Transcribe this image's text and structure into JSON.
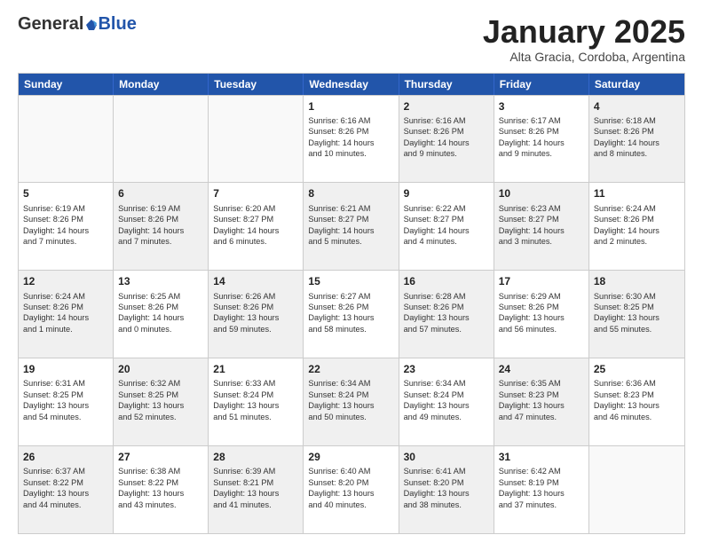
{
  "header": {
    "logo_general": "General",
    "logo_blue": "Blue",
    "title": "January 2025",
    "subtitle": "Alta Gracia, Cordoba, Argentina"
  },
  "weekdays": [
    "Sunday",
    "Monday",
    "Tuesday",
    "Wednesday",
    "Thursday",
    "Friday",
    "Saturday"
  ],
  "weeks": [
    [
      {
        "day": "",
        "info": "",
        "shaded": false,
        "empty": true
      },
      {
        "day": "",
        "info": "",
        "shaded": false,
        "empty": true
      },
      {
        "day": "",
        "info": "",
        "shaded": false,
        "empty": true
      },
      {
        "day": "1",
        "info": "Sunrise: 6:16 AM\nSunset: 8:26 PM\nDaylight: 14 hours\nand 10 minutes.",
        "shaded": false,
        "empty": false
      },
      {
        "day": "2",
        "info": "Sunrise: 6:16 AM\nSunset: 8:26 PM\nDaylight: 14 hours\nand 9 minutes.",
        "shaded": true,
        "empty": false
      },
      {
        "day": "3",
        "info": "Sunrise: 6:17 AM\nSunset: 8:26 PM\nDaylight: 14 hours\nand 9 minutes.",
        "shaded": false,
        "empty": false
      },
      {
        "day": "4",
        "info": "Sunrise: 6:18 AM\nSunset: 8:26 PM\nDaylight: 14 hours\nand 8 minutes.",
        "shaded": true,
        "empty": false
      }
    ],
    [
      {
        "day": "5",
        "info": "Sunrise: 6:19 AM\nSunset: 8:26 PM\nDaylight: 14 hours\nand 7 minutes.",
        "shaded": false,
        "empty": false
      },
      {
        "day": "6",
        "info": "Sunrise: 6:19 AM\nSunset: 8:26 PM\nDaylight: 14 hours\nand 7 minutes.",
        "shaded": true,
        "empty": false
      },
      {
        "day": "7",
        "info": "Sunrise: 6:20 AM\nSunset: 8:27 PM\nDaylight: 14 hours\nand 6 minutes.",
        "shaded": false,
        "empty": false
      },
      {
        "day": "8",
        "info": "Sunrise: 6:21 AM\nSunset: 8:27 PM\nDaylight: 14 hours\nand 5 minutes.",
        "shaded": true,
        "empty": false
      },
      {
        "day": "9",
        "info": "Sunrise: 6:22 AM\nSunset: 8:27 PM\nDaylight: 14 hours\nand 4 minutes.",
        "shaded": false,
        "empty": false
      },
      {
        "day": "10",
        "info": "Sunrise: 6:23 AM\nSunset: 8:27 PM\nDaylight: 14 hours\nand 3 minutes.",
        "shaded": true,
        "empty": false
      },
      {
        "day": "11",
        "info": "Sunrise: 6:24 AM\nSunset: 8:26 PM\nDaylight: 14 hours\nand 2 minutes.",
        "shaded": false,
        "empty": false
      }
    ],
    [
      {
        "day": "12",
        "info": "Sunrise: 6:24 AM\nSunset: 8:26 PM\nDaylight: 14 hours\nand 1 minute.",
        "shaded": true,
        "empty": false
      },
      {
        "day": "13",
        "info": "Sunrise: 6:25 AM\nSunset: 8:26 PM\nDaylight: 14 hours\nand 0 minutes.",
        "shaded": false,
        "empty": false
      },
      {
        "day": "14",
        "info": "Sunrise: 6:26 AM\nSunset: 8:26 PM\nDaylight: 13 hours\nand 59 minutes.",
        "shaded": true,
        "empty": false
      },
      {
        "day": "15",
        "info": "Sunrise: 6:27 AM\nSunset: 8:26 PM\nDaylight: 13 hours\nand 58 minutes.",
        "shaded": false,
        "empty": false
      },
      {
        "day": "16",
        "info": "Sunrise: 6:28 AM\nSunset: 8:26 PM\nDaylight: 13 hours\nand 57 minutes.",
        "shaded": true,
        "empty": false
      },
      {
        "day": "17",
        "info": "Sunrise: 6:29 AM\nSunset: 8:26 PM\nDaylight: 13 hours\nand 56 minutes.",
        "shaded": false,
        "empty": false
      },
      {
        "day": "18",
        "info": "Sunrise: 6:30 AM\nSunset: 8:25 PM\nDaylight: 13 hours\nand 55 minutes.",
        "shaded": true,
        "empty": false
      }
    ],
    [
      {
        "day": "19",
        "info": "Sunrise: 6:31 AM\nSunset: 8:25 PM\nDaylight: 13 hours\nand 54 minutes.",
        "shaded": false,
        "empty": false
      },
      {
        "day": "20",
        "info": "Sunrise: 6:32 AM\nSunset: 8:25 PM\nDaylight: 13 hours\nand 52 minutes.",
        "shaded": true,
        "empty": false
      },
      {
        "day": "21",
        "info": "Sunrise: 6:33 AM\nSunset: 8:24 PM\nDaylight: 13 hours\nand 51 minutes.",
        "shaded": false,
        "empty": false
      },
      {
        "day": "22",
        "info": "Sunrise: 6:34 AM\nSunset: 8:24 PM\nDaylight: 13 hours\nand 50 minutes.",
        "shaded": true,
        "empty": false
      },
      {
        "day": "23",
        "info": "Sunrise: 6:34 AM\nSunset: 8:24 PM\nDaylight: 13 hours\nand 49 minutes.",
        "shaded": false,
        "empty": false
      },
      {
        "day": "24",
        "info": "Sunrise: 6:35 AM\nSunset: 8:23 PM\nDaylight: 13 hours\nand 47 minutes.",
        "shaded": true,
        "empty": false
      },
      {
        "day": "25",
        "info": "Sunrise: 6:36 AM\nSunset: 8:23 PM\nDaylight: 13 hours\nand 46 minutes.",
        "shaded": false,
        "empty": false
      }
    ],
    [
      {
        "day": "26",
        "info": "Sunrise: 6:37 AM\nSunset: 8:22 PM\nDaylight: 13 hours\nand 44 minutes.",
        "shaded": true,
        "empty": false
      },
      {
        "day": "27",
        "info": "Sunrise: 6:38 AM\nSunset: 8:22 PM\nDaylight: 13 hours\nand 43 minutes.",
        "shaded": false,
        "empty": false
      },
      {
        "day": "28",
        "info": "Sunrise: 6:39 AM\nSunset: 8:21 PM\nDaylight: 13 hours\nand 41 minutes.",
        "shaded": true,
        "empty": false
      },
      {
        "day": "29",
        "info": "Sunrise: 6:40 AM\nSunset: 8:20 PM\nDaylight: 13 hours\nand 40 minutes.",
        "shaded": false,
        "empty": false
      },
      {
        "day": "30",
        "info": "Sunrise: 6:41 AM\nSunset: 8:20 PM\nDaylight: 13 hours\nand 38 minutes.",
        "shaded": true,
        "empty": false
      },
      {
        "day": "31",
        "info": "Sunrise: 6:42 AM\nSunset: 8:19 PM\nDaylight: 13 hours\nand 37 minutes.",
        "shaded": false,
        "empty": false
      },
      {
        "day": "",
        "info": "",
        "shaded": false,
        "empty": true
      }
    ]
  ]
}
